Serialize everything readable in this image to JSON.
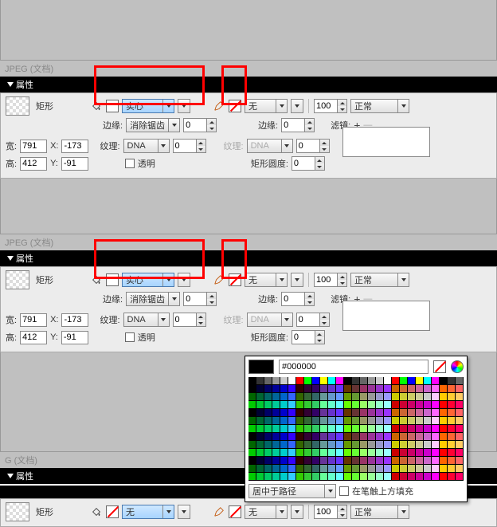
{
  "jpeg_label": "JPEG (文档)",
  "g_label": "G (文档)",
  "panel_title": "属性",
  "shape_label": "矩形",
  "fill_combo": "实心",
  "stroke_combo": "无",
  "opacity": "100",
  "blend": "正常",
  "blend2": "正常",
  "edge_label": "边缘:",
  "edge_value": "消除锯齿",
  "edge_label2": "边缘:",
  "edge_spin": "0",
  "texture_label": "纹理:",
  "texture_value": "DNA",
  "texture_spin": "0",
  "texture_label2": "纹理:",
  "texture_value2": "DNA",
  "texture_spin2": "0",
  "width_label": "宽:",
  "width_val": "791",
  "height_label": "高:",
  "height_val": "412",
  "x_label": "X:",
  "x_val": "-173",
  "y_label": "Y:",
  "y_val": "-91",
  "transp_label": "透明",
  "filter_label": "滤镜:",
  "round_label": "矩形圆度:",
  "round_val": "0",
  "hex_value": "#000000",
  "path_center": "居中于路径",
  "stroke_over": "在笔触上方填充",
  "fill3": "无",
  "plus": "+"
}
